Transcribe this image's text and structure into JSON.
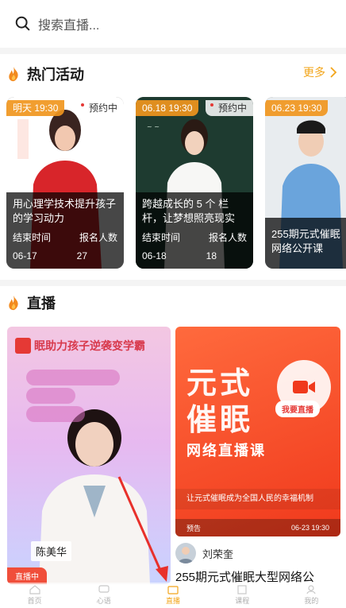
{
  "search": {
    "placeholder": "搜索直播..."
  },
  "hot": {
    "title": "热门活动",
    "more": "更多",
    "cards": [
      {
        "date": "明天 19:30",
        "status": "预约中",
        "title": "用心理学技术提升孩子的学习动力",
        "end_label": "结束时间",
        "count_label": "报名人数",
        "end": "06-17",
        "count": "27"
      },
      {
        "date": "06.18 19:30",
        "status": "预约中",
        "title": "跨越成长的 5 个 栏杆，让梦想照亮现实",
        "end_label": "结束时间",
        "count_label": "报名人数",
        "end": "06-18",
        "count": "18"
      },
      {
        "date": "06.23 19:30",
        "title": "255期元式催眠网络公开课"
      }
    ]
  },
  "live": {
    "title": "直播",
    "card1": {
      "headline": "眠助力孩子逆袭变学霸",
      "name": "陈美华",
      "badge": "直播中"
    },
    "card2": {
      "big1": "元式",
      "big2": "催眠",
      "sub": "网络直播课",
      "go": "我要直播",
      "slogan": "让元式催眠成为全国人民的幸福机制",
      "strip_left": "预告",
      "strip_right": "06-23 19:30",
      "author": "刘荣奎",
      "title": "255期元式催眠大型网络公"
    }
  },
  "tabs": [
    "首页",
    "心语",
    "直播",
    "课程",
    "我的"
  ],
  "colors": {
    "accent": "#f2a51a",
    "live_red": "#f04e3a"
  }
}
